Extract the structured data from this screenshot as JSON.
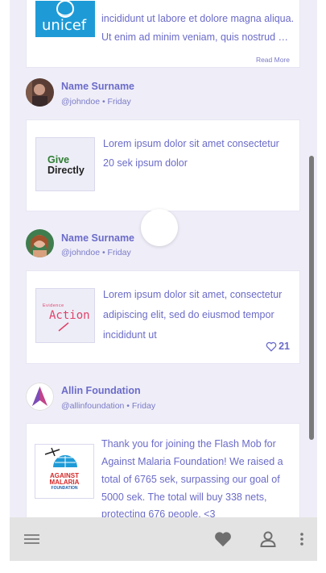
{
  "feed": {
    "top_card": {
      "logo_text": "unicef",
      "line1": "incididunt ut labore et dolore magna aliqua.",
      "line2": "Ut enim ad minim veniam, quis nostrud …",
      "read_more": "Read More"
    },
    "posts": [
      {
        "name": "Name Surname",
        "meta": "@johndoe • Friday",
        "logo_text": "Give Directly",
        "logo_line1": "Give",
        "logo_line2": "Directly",
        "lines": [
          "Lorem ipsum dolor sit amet consectetur",
          "20 sek ipsum dolor"
        ]
      },
      {
        "name": "Name Surname",
        "meta": "@johndoe • Friday",
        "logo_text": "Evidence Action",
        "logo_small": "Evidence",
        "logo_big": "Action",
        "lines": [
          "Lorem ipsum dolor sit amet, consectetur",
          "adipiscing elit, sed do eiusmod tempor",
          "incididunt ut"
        ],
        "likes": "21"
      },
      {
        "name": "Allin Foundation",
        "meta": "@allinfoundation • Friday",
        "logo_line1": "AGAINST",
        "logo_line2": "MALARIA",
        "logo_line3": "FOUNDATION",
        "lines": [
          "Thank you for joining the Flash Mob for",
          "Against Malaria Foundation! We raised a",
          "total of 6765 sek, surpassing our goal of",
          "5000 sek. The total will buy 338 nets,",
          "protecting 676 people. <3"
        ]
      }
    ]
  },
  "bottom_bar": {
    "menu_icon": "menu-icon",
    "heart_icon": "heart-icon",
    "profile_icon": "user-icon",
    "more_icon": "more-vertical-icon"
  },
  "colors": {
    "accent": "#6b6bc9",
    "background": "#efeef8",
    "bar": "#e3e3e3"
  }
}
